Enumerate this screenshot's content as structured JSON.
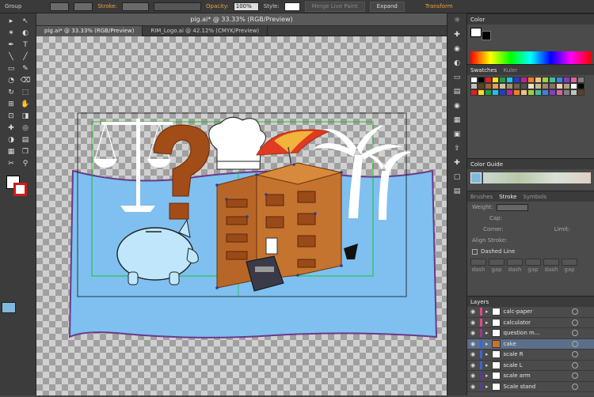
{
  "toolbar": {
    "selection": "Group",
    "stroke_label": "Stroke:",
    "opacity_label": "Opacity:",
    "opacity_value": "100%",
    "style_label": "Style:",
    "merge_label": "Merge Live Paint",
    "expand_label": "Expand",
    "transform_label": "Transform"
  },
  "document": {
    "title": "pig.ai* @ 33.33% (RGB/Preview)",
    "tabs": [
      {
        "label": "pig.ai* @ 33.33% (RGB/Preview)"
      },
      {
        "label": "RIM_Logo.ai @ 42.12% (CMYK/Preview)"
      }
    ]
  },
  "tools": [
    "▸",
    "↖",
    "✶",
    "◐",
    "✒",
    "T",
    "╲",
    "╱",
    "▭",
    "✎",
    "◔",
    "⌫",
    "↻",
    "⬚",
    "⊞",
    "✋",
    "⊡",
    "◨",
    "✚",
    "◎",
    "◑",
    "▤",
    "▦",
    "❐",
    "✂",
    "⚲"
  ],
  "dock_icons": [
    "☼",
    "✚",
    "◉",
    "◐",
    "▭",
    "▤",
    "◉",
    "▦",
    "▣",
    "⇧",
    "✚",
    "▢",
    "▤"
  ],
  "panels": {
    "color": {
      "title": "Color"
    },
    "swatches": {
      "title": "Swatches",
      "tab2": "Kuler"
    },
    "color_guide": {
      "title": "Color Guide"
    },
    "stroke": {
      "tabs": [
        "Brushes",
        "Stroke",
        "Symbols"
      ],
      "weight_label": "Weight:",
      "cap_label": "Cap:",
      "corner_label": "Corner:",
      "limit_label": "Limit:",
      "align_label": "Align Stroke:",
      "dashed_label": "Dashed Line",
      "dash_labels": [
        "dash",
        "gap",
        "dash",
        "gap",
        "dash",
        "gap"
      ]
    },
    "layers": {
      "title": "Layers",
      "items": [
        {
          "name": "calc-paper",
          "color": "#e04a8a"
        },
        {
          "name": "calculator",
          "color": "#e04a8a"
        },
        {
          "name": "question m...",
          "color": "#9a3a8a"
        },
        {
          "name": "cake",
          "color": "#3a68d0"
        },
        {
          "name": "scale R",
          "color": "#3a68d0"
        },
        {
          "name": "scale L",
          "color": "#3a68d0"
        },
        {
          "name": "scale arm",
          "color": "#5a3a9a"
        },
        {
          "name": "Scale stand",
          "color": "#5a3a9a"
        }
      ]
    }
  },
  "colors": {
    "accent": "#f0a040",
    "selection": "#2a3a9a",
    "guide": "#00c000",
    "water": "#7fc0f0"
  }
}
